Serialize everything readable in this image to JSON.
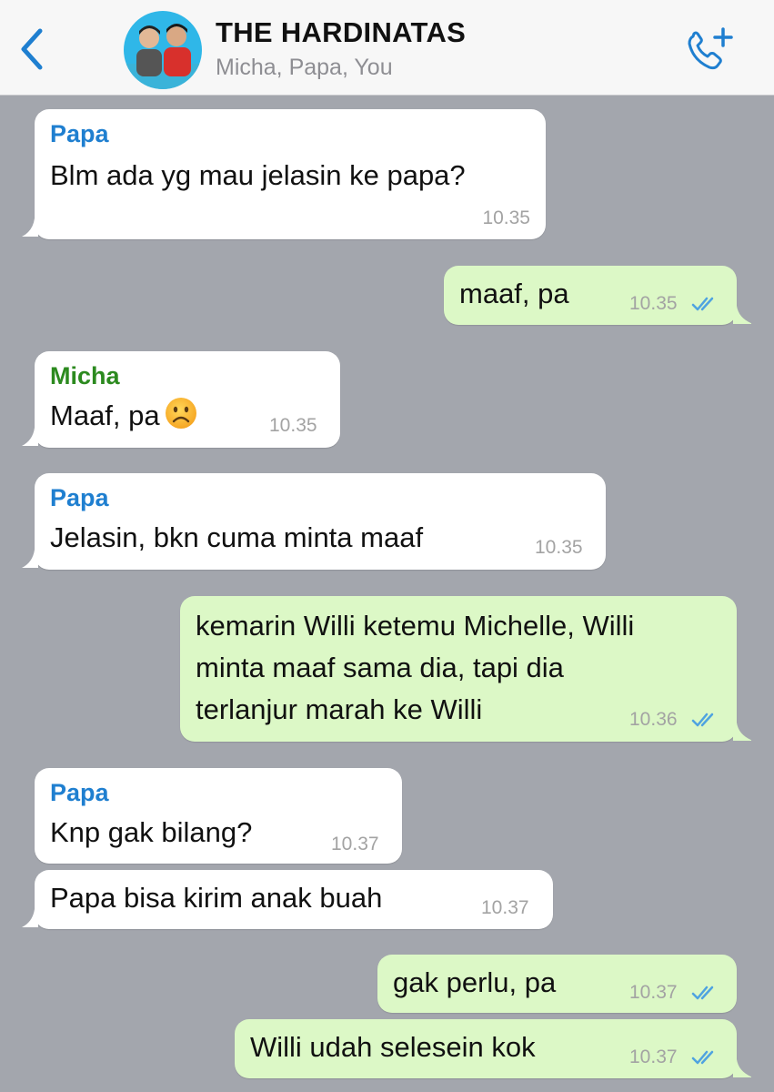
{
  "header": {
    "back_label": "Back",
    "title": "THE HARDINATAS",
    "members": "Micha, Papa, You"
  },
  "colors": {
    "background": "#a3a6ad",
    "incoming_bubble": "#ffffff",
    "outgoing_bubble": "#dcf8c6",
    "accent_blue": "#1f7fd0",
    "sender_papa": "#1f7fd0",
    "sender_micha": "#2c8a1f",
    "read_ticks": "#4fa3e0"
  },
  "icons": {
    "back": "chevron-left-icon",
    "call": "phone-add-icon",
    "read": "double-check-icon",
    "emoji": "frowning-face-emoji"
  },
  "messages": [
    {
      "direction": "in",
      "sender": "Papa",
      "text": "Blm ada yg mau jelasin ke papa?",
      "time": "10.35"
    },
    {
      "direction": "out",
      "text": "maaf, pa",
      "time": "10.35",
      "read": true
    },
    {
      "direction": "in",
      "sender": "Micha",
      "text": "Maaf, pa",
      "emoji": "☹️",
      "time": "10.35"
    },
    {
      "direction": "in",
      "sender": "Papa",
      "text": "Jelasin, bkn cuma minta maaf",
      "time": "10.35"
    },
    {
      "direction": "out",
      "lines": [
        "kemarin Willi ketemu Michelle, Willi",
        "minta maaf sama dia, tapi dia",
        "terlanjur marah ke Willi"
      ],
      "time": "10.36",
      "read": true
    },
    {
      "direction": "in",
      "sender": "Papa",
      "text": "Knp gak bilang?",
      "time": "10.37"
    },
    {
      "direction": "in",
      "text": "Papa bisa kirim anak buah",
      "time": "10.37"
    },
    {
      "direction": "out",
      "text": "gak perlu, pa",
      "time": "10.37",
      "read": true
    },
    {
      "direction": "out",
      "text": "Willi udah selesein kok",
      "time": "10.37",
      "read": true
    }
  ]
}
